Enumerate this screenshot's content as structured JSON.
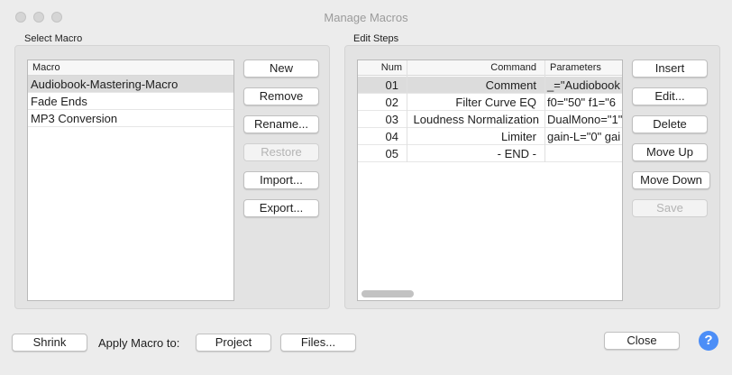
{
  "window": {
    "title": "Manage Macros"
  },
  "select_macro": {
    "group_label": "Select Macro",
    "column_header": "Macro",
    "items": [
      {
        "label": "Audiobook-Mastering-Macro",
        "selected": true
      },
      {
        "label": "Fade Ends",
        "selected": false
      },
      {
        "label": "MP3 Conversion",
        "selected": false
      }
    ],
    "buttons": {
      "new": "New",
      "remove": "Remove",
      "rename": "Rename...",
      "restore": "Restore",
      "import": "Import...",
      "export": "Export..."
    }
  },
  "edit_steps": {
    "group_label": "Edit Steps",
    "columns": {
      "num": "Num",
      "command": "Command",
      "parameters": "Parameters"
    },
    "rows": [
      {
        "num": "01",
        "command": "Comment",
        "parameters": "_=\"Audiobook",
        "selected": true
      },
      {
        "num": "02",
        "command": "Filter Curve EQ",
        "parameters": "f0=\"50\" f1=\"6"
      },
      {
        "num": "03",
        "command": "Loudness Normalization",
        "parameters": "DualMono=\"1\""
      },
      {
        "num": "04",
        "command": "Limiter",
        "parameters": "gain-L=\"0\" gai"
      },
      {
        "num": "05",
        "command": "- END -",
        "parameters": ""
      }
    ],
    "buttons": {
      "insert": "Insert",
      "edit": "Edit...",
      "delete": "Delete",
      "move_up": "Move Up",
      "move_down": "Move Down",
      "save": "Save"
    }
  },
  "footer": {
    "shrink": "Shrink",
    "apply_label": "Apply Macro to:",
    "project": "Project",
    "files": "Files...",
    "close": "Close",
    "help": "?"
  }
}
